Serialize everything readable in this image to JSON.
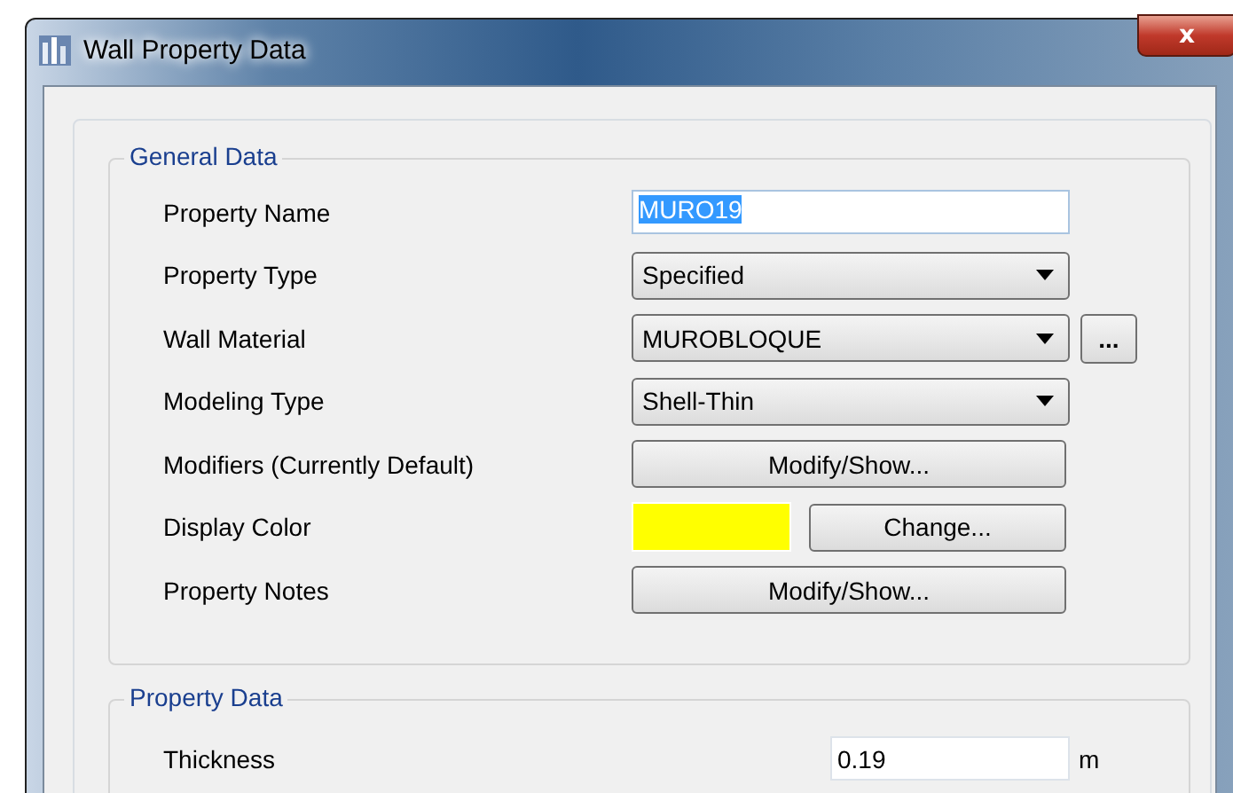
{
  "window": {
    "title": "Wall Property Data",
    "close": "x"
  },
  "general_data": {
    "title": "General Data",
    "rows": [
      {
        "label": "Property Name",
        "kind": "text",
        "value": "MURO19",
        "selected": true
      },
      {
        "label": "Property Type",
        "kind": "dropdown",
        "value": "Specified"
      },
      {
        "label": "Wall Material",
        "kind": "dropdown",
        "value": "MUROBLOQUE",
        "extra_button": "..."
      },
      {
        "label": "Modeling Type",
        "kind": "dropdown",
        "value": "Shell-Thin"
      },
      {
        "label": "Modifiers (Currently Default)",
        "kind": "button",
        "button": "Modify/Show..."
      },
      {
        "label": "Display Color",
        "kind": "color",
        "color": "#ffff00",
        "button": "Change..."
      },
      {
        "label": "Property Notes",
        "kind": "button",
        "button": "Modify/Show..."
      }
    ]
  },
  "property_data": {
    "title": "Property Data",
    "rows": [
      {
        "label": "Thickness",
        "value": "0.19",
        "unit": "m"
      }
    ]
  }
}
